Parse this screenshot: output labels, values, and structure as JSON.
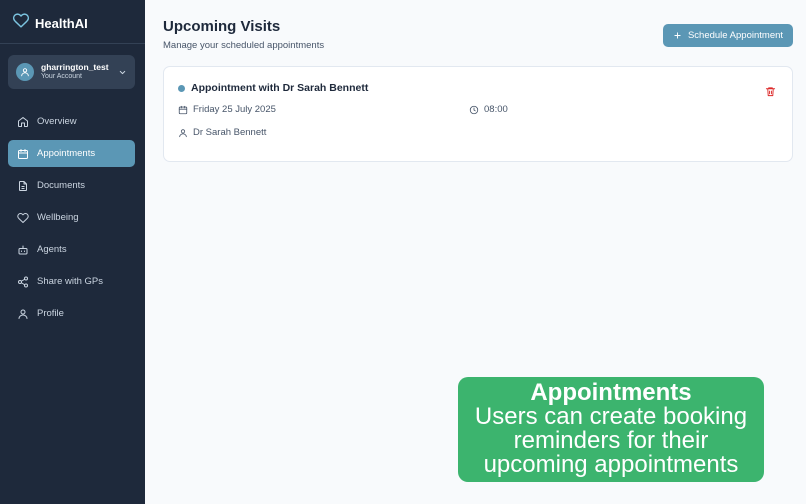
{
  "brand": {
    "name": "HealthAI"
  },
  "account": {
    "username": "gharrington_test",
    "subtitle": "Your Account"
  },
  "nav": [
    {
      "label": "Overview",
      "icon": "home-icon"
    },
    {
      "label": "Appointments",
      "icon": "calendar-icon",
      "active": true
    },
    {
      "label": "Documents",
      "icon": "document-icon"
    },
    {
      "label": "Wellbeing",
      "icon": "heart-icon"
    },
    {
      "label": "Agents",
      "icon": "bot-icon"
    },
    {
      "label": "Share with GPs",
      "icon": "share-icon"
    },
    {
      "label": "Profile",
      "icon": "user-icon"
    }
  ],
  "page": {
    "title": "Upcoming Visits",
    "subtitle": "Manage your scheduled appointments",
    "schedule_button": "Schedule Appointment"
  },
  "appointment": {
    "title": "Appointment with Dr Sarah Bennett",
    "date": "Friday 25 July 2025",
    "time": "08:00",
    "doctor": "Dr Sarah Bennett"
  },
  "banner": {
    "title": "Appointments",
    "text": "Users can create booking reminders for their upcoming appointments"
  },
  "colors": {
    "sidebar_bg": "#1e293b",
    "accent": "#5b97b5",
    "banner_bg": "#3cb46e",
    "delete": "#dc2626"
  }
}
